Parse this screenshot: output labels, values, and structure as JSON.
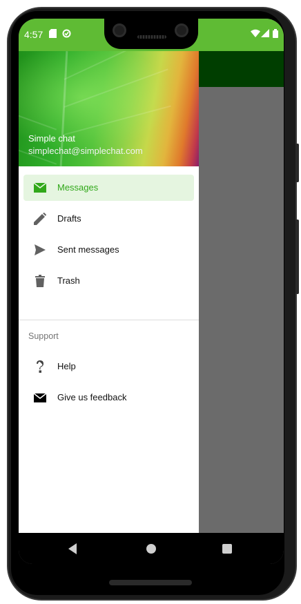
{
  "status_bar": {
    "time": "4:57",
    "background_color": "#5fbb34"
  },
  "drawer": {
    "header": {
      "name": "Simple chat",
      "email": "simplechat@simplechat.com"
    },
    "primary_items": [
      {
        "label": "Messages",
        "icon": "mail-icon",
        "active": true
      },
      {
        "label": "Drafts",
        "icon": "pencil-icon",
        "active": false
      },
      {
        "label": "Sent messages",
        "icon": "send-icon",
        "active": false
      },
      {
        "label": "Trash",
        "icon": "trash-icon",
        "active": false
      }
    ],
    "section_title": "Support",
    "support_items": [
      {
        "label": "Help",
        "icon": "help-icon"
      },
      {
        "label": "Give us feedback",
        "icon": "feedback-mail-icon"
      }
    ]
  },
  "colors": {
    "accent": "#31a81a",
    "active_bg": "#e5f5e0",
    "toolbar": "#003e00",
    "scrim": "#6b6b6b"
  }
}
